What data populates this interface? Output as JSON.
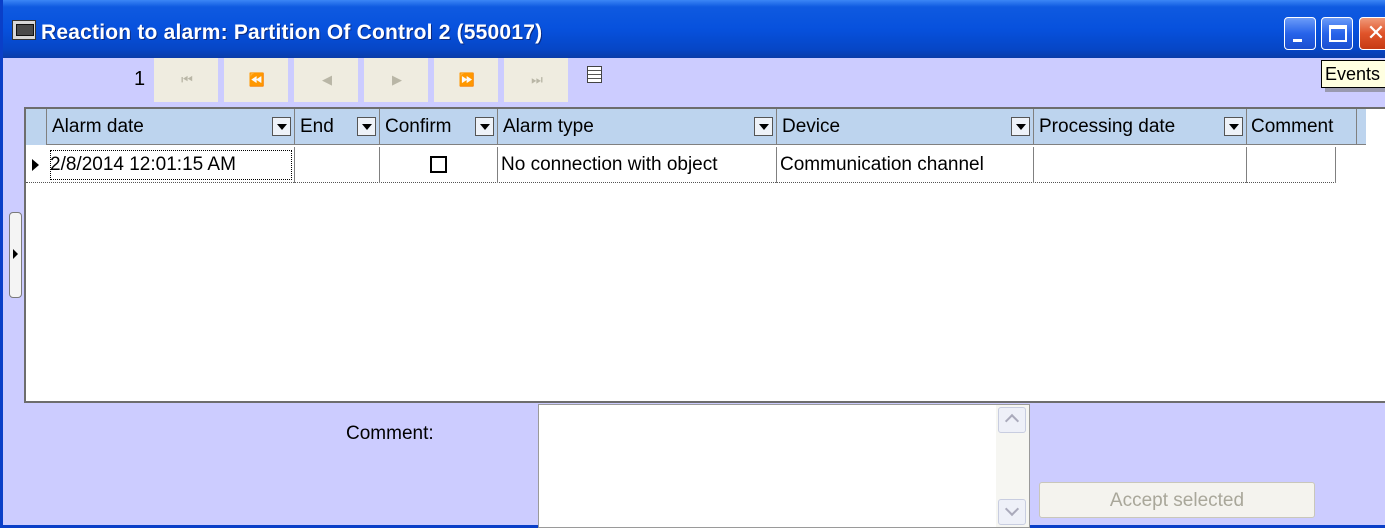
{
  "window": {
    "title": "Reaction to alarm: Partition Of Control 2 (550017)"
  },
  "toolbar": {
    "page_number": "1",
    "nav_buttons": [
      {
        "name": "first-page",
        "glyph": "⏮"
      },
      {
        "name": "prev-page",
        "glyph": "⏪"
      },
      {
        "name": "prev-record",
        "glyph": "◀"
      },
      {
        "name": "next-record",
        "glyph": "▶"
      },
      {
        "name": "next-page",
        "glyph": "⏩"
      },
      {
        "name": "last-page",
        "glyph": "⏭"
      }
    ],
    "tooltip": "Events"
  },
  "grid": {
    "columns": [
      {
        "label": "Alarm date",
        "filter": true
      },
      {
        "label": "End",
        "filter": true
      },
      {
        "label": "Confirm",
        "filter": true
      },
      {
        "label": "Alarm type",
        "filter": true
      },
      {
        "label": "Device",
        "filter": true
      },
      {
        "label": "Processing date",
        "filter": true
      },
      {
        "label": "Comment",
        "filter": false
      }
    ],
    "rows": [
      {
        "alarm_date": "2/8/2014 12:01:15 AM",
        "end": "",
        "confirm": false,
        "alarm_type": "No connection with object",
        "device": "Communication channel",
        "processing_date": "",
        "comment": ""
      }
    ]
  },
  "comment_panel": {
    "label": "Comment:",
    "value": ""
  },
  "accept_button": {
    "label": "Accept selected",
    "enabled": false
  }
}
